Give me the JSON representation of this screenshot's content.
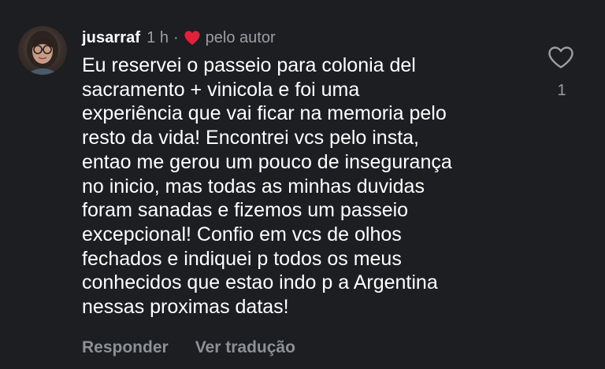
{
  "comment": {
    "username": "jusarraf",
    "time": "1 h",
    "separator": "·",
    "author_badge": {
      "icon": "heart-filled-icon",
      "label": "pelo autor",
      "color": "#e0213c"
    },
    "text": "Eu reservei o passeio para colonia del\nsacramento + vinicola e foi uma\nexperiência que vai ficar na memoria pelo\nresto da vida! Encontrei vcs pelo insta,\nentao me gerou um pouco de insegurança\nno inicio, mas todas as minhas duvidas\nforam sanadas e fizemos um passeio\nexcepcional! Confio em vcs de olhos\nfechados e indiquei p todos os meus\nconhecidos que estao indo p a Argentina\nnessas proximas datas!",
    "actions": {
      "reply": "Responder",
      "translate": "Ver tradução"
    },
    "likes": {
      "icon": "heart-outline-icon",
      "count": "1"
    }
  },
  "colors": {
    "background": "#1c1e21",
    "primary_text": "#ffffff",
    "secondary_text": "#9a9ea5",
    "heart_red": "#e0213c"
  }
}
